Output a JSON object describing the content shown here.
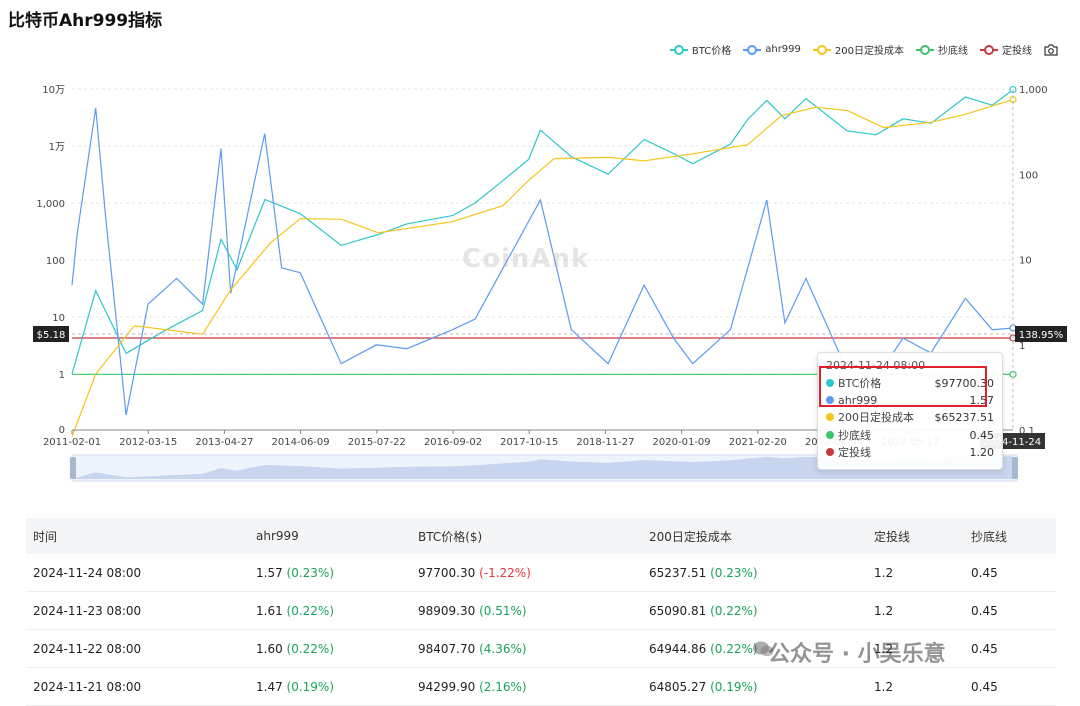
{
  "page_title": "比特币Ahr999指标",
  "legend": [
    {
      "label": "BTC价格",
      "color": "#2ec7c9"
    },
    {
      "label": "ahr999",
      "color": "#5b9bf0"
    },
    {
      "label": "200日定投成本",
      "color": "#f5c518"
    },
    {
      "label": "抄底线",
      "color": "#3cc46a"
    },
    {
      "label": "定投线",
      "color": "#c8383e"
    }
  ],
  "watermark": "CoinAnk",
  "chart_data": {
    "type": "line",
    "title": "比特币Ahr999指标",
    "left_axis": {
      "scale": "log",
      "ticks": [
        "10万",
        "1万",
        "1,000",
        "100",
        "10",
        "1",
        "0"
      ]
    },
    "right_axis": {
      "scale": "log",
      "ticks": [
        "1,000",
        "100",
        "10",
        "1",
        "0.1"
      ]
    },
    "x_ticks": [
      "2011-02-01",
      "2012-03-15",
      "2013-04-27",
      "2014-06-09",
      "2015-07-22",
      "2016-09-02",
      "2017-10-15",
      "2018-11-27",
      "2020-01-09",
      "2021-02-20",
      "2022-04-04",
      "2023-05-17",
      "2024-11-24"
    ],
    "series": [
      {
        "name": "BTC价格",
        "axis": "left",
        "color": "#2ec7c9",
        "x": [
          "2011-02-01",
          "2011-06-08",
          "2011-11-18",
          "2012-06-01",
          "2013-01-01",
          "2013-04-10",
          "2013-07-05",
          "2013-12-01",
          "2014-06-09",
          "2015-01-14",
          "2015-08-01",
          "2016-01-01",
          "2016-09-02",
          "2017-01-01",
          "2017-06-01",
          "2017-10-15",
          "2017-12-17",
          "2018-06-01",
          "2018-12-15",
          "2019-06-26",
          "2019-12-01",
          "2020-03-13",
          "2020-10-01",
          "2021-01-01",
          "2021-04-14",
          "2021-07-20",
          "2021-11-10",
          "2022-06-18",
          "2022-11-21",
          "2023-04-14",
          "2023-09-11",
          "2024-03-14",
          "2024-08-05",
          "2024-11-24"
        ],
        "values": [
          1,
          29,
          2.3,
          5.5,
          13,
          230,
          68,
          1150,
          650,
          180,
          280,
          430,
          600,
          1000,
          2500,
          5800,
          19000,
          6500,
          3200,
          13000,
          7400,
          4900,
          10800,
          29000,
          63000,
          30000,
          68000,
          18500,
          15700,
          30000,
          25000,
          72000,
          52000,
          97700.3
        ]
      },
      {
        "name": "ahr999",
        "axis": "right",
        "color": "#5b9bf0",
        "x": [
          "2011-02-01",
          "2011-03-01",
          "2011-06-08",
          "2011-08-01",
          "2011-11-18",
          "2012-03-15",
          "2012-08-15",
          "2013-01-01",
          "2013-04-10",
          "2013-06-01",
          "2013-11-30",
          "2014-03-01",
          "2014-06-09",
          "2015-01-14",
          "2015-07-22",
          "2016-01-01",
          "2016-09-02",
          "2017-01-01",
          "2017-06-01",
          "2017-12-17",
          "2018-06-01",
          "2018-12-15",
          "2019-06-26",
          "2019-12-01",
          "2020-03-13",
          "2020-10-01",
          "2021-04-14",
          "2021-07-20",
          "2021-11-10",
          "2022-06-18",
          "2022-11-21",
          "2023-04-14",
          "2023-09-11",
          "2024-03-14",
          "2024-08-05",
          "2024-11-24"
        ],
        "values": [
          5,
          20,
          600,
          30,
          0.15,
          3,
          6,
          3,
          200,
          4,
          300,
          8,
          7,
          0.6,
          1,
          0.9,
          1.5,
          2,
          8,
          50,
          1.5,
          0.6,
          5,
          1.2,
          0.6,
          1.5,
          50,
          1.8,
          6,
          0.5,
          0.4,
          1.2,
          0.8,
          3.5,
          1.5,
          1.57
        ]
      },
      {
        "name": "200日定投成本",
        "axis": "left",
        "color": "#f5c518",
        "x": [
          "2011-02-01",
          "2011-06-08",
          "2012-01-01",
          "2013-01-01",
          "2013-06-01",
          "2014-01-01",
          "2014-06-09",
          "2015-01-14",
          "2015-08-01",
          "2016-09-02",
          "2017-06-01",
          "2017-10-15",
          "2018-03-01",
          "2018-12-15",
          "2019-06-26",
          "2020-03-13",
          "2021-01-01",
          "2021-07-01",
          "2022-01-01",
          "2022-06-18",
          "2023-01-01",
          "2023-09-11",
          "2024-03-14",
          "2024-11-24"
        ],
        "values": [
          0.08,
          1,
          7,
          5,
          30,
          200,
          530,
          520,
          300,
          470,
          900,
          2500,
          6000,
          6300,
          5500,
          7300,
          10500,
          34000,
          48000,
          42000,
          21000,
          26000,
          36000,
          65237.51
        ]
      },
      {
        "name": "抄底线",
        "axis": "right",
        "color": "#3cc46a",
        "constant": 0.45
      },
      {
        "name": "定投线",
        "axis": "right",
        "color": "#c8383e",
        "constant": 1.2
      }
    ],
    "left_marker": "$5.18",
    "right_marker": "138.95%",
    "range_end_label": "2024-11-24"
  },
  "tooltip": {
    "date": "2024-11-24 08:00",
    "rows": [
      {
        "label": "BTC价格",
        "value": "$97700.30",
        "color": "#2ec7c9"
      },
      {
        "label": "ahr999",
        "value": "1.57",
        "color": "#5b9bf0"
      },
      {
        "label": "200日定投成本",
        "value": "$65237.51",
        "color": "#f5c518"
      },
      {
        "label": "抄底线",
        "value": "0.45",
        "color": "#3cc46a"
      },
      {
        "label": "定投线",
        "value": "1.20",
        "color": "#c8383e"
      }
    ]
  },
  "table": {
    "headers": [
      "时间",
      "ahr999",
      "BTC价格($)",
      "200日定投成本",
      "定投线",
      "抄底线"
    ],
    "rows": [
      {
        "time": "2024-11-24 08:00",
        "ahr": "1.57",
        "ahr_chg": "(0.23%)",
        "price": "97700.30",
        "price_chg": "(-1.22%)",
        "price_neg": true,
        "cost": "65237.51",
        "cost_chg": "(0.23%)",
        "dca": "1.2",
        "bottom": "0.45"
      },
      {
        "time": "2024-11-23 08:00",
        "ahr": "1.61",
        "ahr_chg": "(0.22%)",
        "price": "98909.30",
        "price_chg": "(0.51%)",
        "price_neg": false,
        "cost": "65090.81",
        "cost_chg": "(0.22%)",
        "dca": "1.2",
        "bottom": "0.45"
      },
      {
        "time": "2024-11-22 08:00",
        "ahr": "1.60",
        "ahr_chg": "(0.22%)",
        "price": "98407.70",
        "price_chg": "(4.36%)",
        "price_neg": false,
        "cost": "64944.86",
        "cost_chg": "(0.22%)",
        "dca": "1.2",
        "bottom": "0.45"
      },
      {
        "time": "2024-11-21 08:00",
        "ahr": "1.47",
        "ahr_chg": "(0.19%)",
        "price": "94299.90",
        "price_chg": "(2.16%)",
        "price_neg": false,
        "cost": "64805.27",
        "cost_chg": "(0.19%)",
        "dca": "1.2",
        "bottom": "0.45"
      }
    ]
  },
  "footer_watermark": "公众号 · 小吴乐意"
}
